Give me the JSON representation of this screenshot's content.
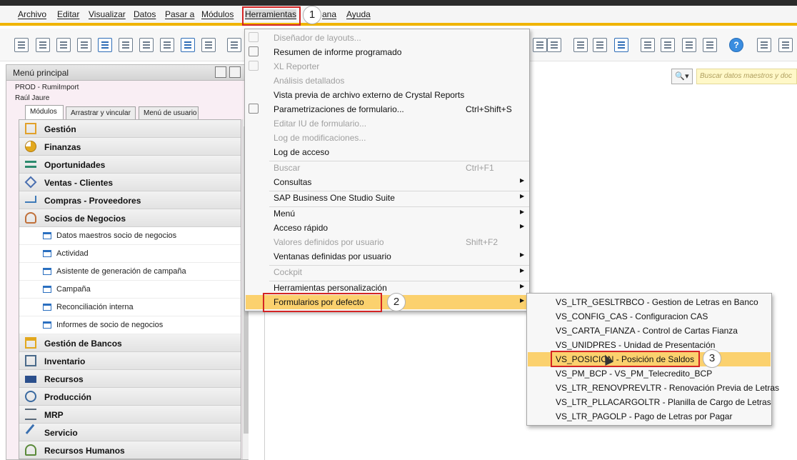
{
  "menubar": {
    "items": [
      "Archivo",
      "Editar",
      "Visualizar",
      "Datos",
      "Pasar a",
      "Módulos",
      "Herramientas",
      "ana",
      "Ayuda"
    ]
  },
  "toolbar": {
    "icons": [
      "print-preview-icon",
      "print-icon",
      "email-icon",
      "sms-icon",
      "fax-icon",
      "excel-icon",
      "word-icon",
      "pdf-icon",
      "move-icon",
      "lock-icon",
      "binoculars-icon",
      "edit-icon",
      "add-document-icon",
      "settings-icon",
      "checklist-icon",
      "mail-alert-icon",
      "grid-icon",
      "hierarchy-icon",
      "help-icon",
      "tile-icon"
    ]
  },
  "search": {
    "placeholder": "Buscar datos maestros y doc"
  },
  "panel": {
    "title": "Menú principal",
    "company": "PROD - RumiImport",
    "user": "Raúl Jaure",
    "tabs": [
      "Módulos",
      "Arrastrar y vincular",
      "Menú de usuario"
    ],
    "modules": [
      {
        "label": "Gestión",
        "icon": "gestion-icon",
        "color": "#e1a12a"
      },
      {
        "label": "Finanzas",
        "icon": "pie-chart-icon",
        "color": "#e2a81e"
      },
      {
        "label": "Oportunidades",
        "icon": "opportunity-icon",
        "color": "#2d8a6e"
      },
      {
        "label": "Ventas - Clientes",
        "icon": "sales-tag-icon",
        "color": "#4a6fb0"
      },
      {
        "label": "Compras - Proveedores",
        "icon": "cart-icon",
        "color": "#3e7ab8"
      },
      {
        "label": "Socios de Negocios",
        "icon": "business-partners-icon",
        "color": "#c0703a"
      }
    ],
    "sub_items": [
      "Datos maestros socio de negocios",
      "Actividad",
      "Asistente de generación de campaña",
      "Campaña",
      "Reconciliación interna",
      "Informes de socio de negocios"
    ],
    "modules_after": [
      {
        "label": "Gestión de Bancos",
        "icon": "bank-icon",
        "color": "#e2a81e"
      },
      {
        "label": "Inventario",
        "icon": "inventory-icon",
        "color": "#4a6a8a"
      },
      {
        "label": "Recursos",
        "icon": "factory-icon",
        "color": "#2b4f8c"
      },
      {
        "label": "Producción",
        "icon": "production-icon",
        "color": "#3a6aa0"
      },
      {
        "label": "MRP",
        "icon": "mrp-icon",
        "color": "#5a6a7a"
      },
      {
        "label": "Servicio",
        "icon": "service-icon",
        "color": "#3a70b0"
      },
      {
        "label": "Recursos Humanos",
        "icon": "human-resources-icon",
        "color": "#5a8a3a"
      }
    ]
  },
  "dropdown": {
    "items": [
      {
        "label": "Diseñador de layouts...",
        "disabled": true
      },
      {
        "label": "Resumen de informe programado"
      },
      {
        "label": "XL Reporter",
        "disabled": true
      },
      {
        "label": "Análisis detallados",
        "disabled": true
      },
      {
        "label": "Vista previa de archivo externo de Crystal Reports"
      },
      {
        "label": "Parametrizaciones de formulario...",
        "shortcut": "Ctrl+Shift+S"
      },
      {
        "label": "Editar IU de formulario...",
        "disabled": true
      },
      {
        "label": "Log de modificaciones...",
        "disabled": true
      },
      {
        "label": "Log de acceso"
      },
      {
        "label": "Buscar",
        "disabled": true,
        "shortcut": "Ctrl+F1"
      },
      {
        "label": "Consultas",
        "submenu": true
      },
      {
        "label": "SAP Business One Studio Suite",
        "submenu": true
      },
      {
        "label": "Menú",
        "submenu": true
      },
      {
        "label": "Acceso rápido",
        "submenu": true
      },
      {
        "label": "Valores definidos por usuario",
        "disabled": true,
        "shortcut": "Shift+F2"
      },
      {
        "label": "Ventanas definidas por usuario",
        "submenu": true
      },
      {
        "label": "Cockpit",
        "disabled": true,
        "submenu": true
      },
      {
        "label": "Herramientas personalización",
        "submenu": true
      },
      {
        "label": "Formularios por defecto",
        "submenu": true,
        "highlight": true
      }
    ]
  },
  "submenu": {
    "items": [
      "VS_LTR_GESLTRBCO - Gestion de Letras en Banco",
      "VS_CONFIG_CAS - Configuracion CAS",
      "VS_CARTA_FIANZA - Control de Cartas Fianza",
      "VS_UNIDPRES - Unidad de Presentación",
      "VS_POSICION - Posición de Saldos",
      "VS_PM_BCP - VS_PM_Telecredito_BCP",
      "VS_LTR_RENOVPREVLTR - Renovación Previa de Letras",
      "VS_LTR_PLLACARGOLTR - Planilla de Cargo de Letras",
      "VS_LTR_PAGOLP - Pago de Letras por Pagar"
    ],
    "highlight_index": 4
  },
  "callouts": [
    "1",
    "2",
    "3"
  ],
  "colors": {
    "accent": "#f0b400",
    "highlight": "#fbd16e",
    "callout_red": "#d42424"
  }
}
